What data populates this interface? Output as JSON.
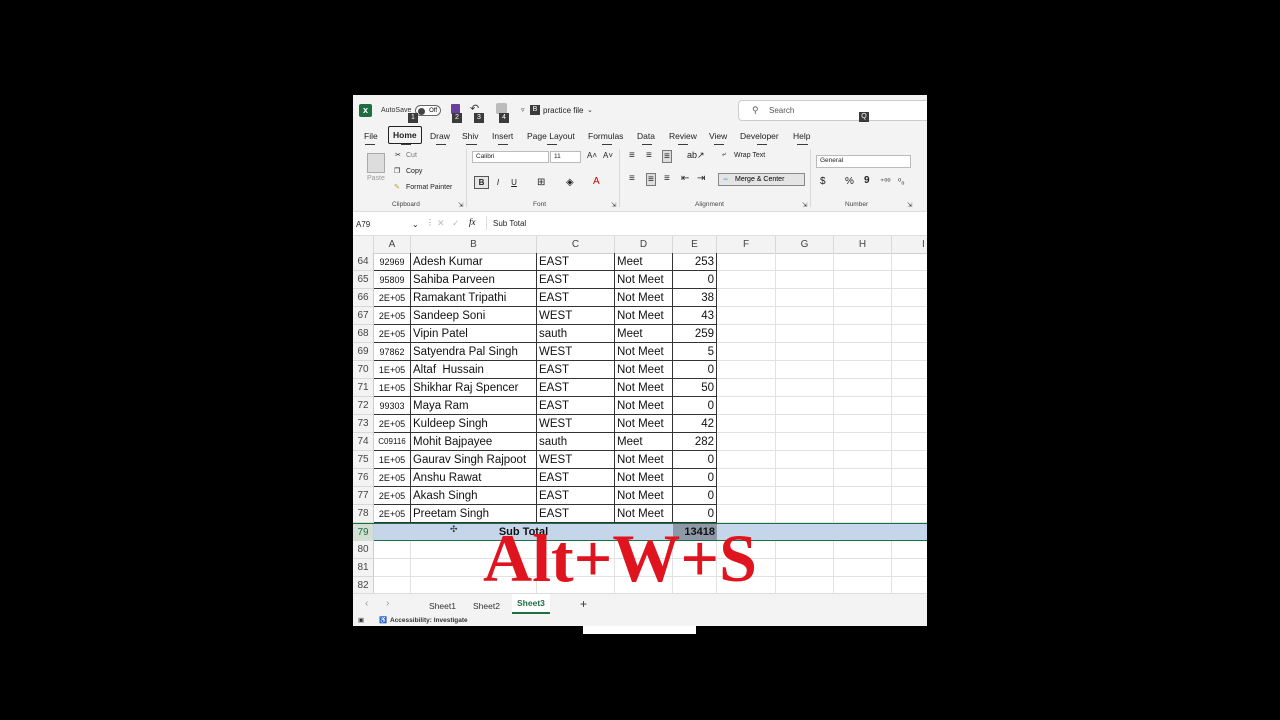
{
  "titlebar": {
    "autosave_label": "AutoSave",
    "autosave_state": "Off",
    "file_name": "practice file",
    "search_placeholder": "Search",
    "keytips": [
      "1",
      "2",
      "3",
      "4",
      "B",
      "Q"
    ]
  },
  "ribbon_tabs": [
    {
      "label": "File",
      "keytip": "F"
    },
    {
      "label": "Home",
      "keytip": "H"
    },
    {
      "label": "Draw",
      "keytip": "JI"
    },
    {
      "label": "Shiv",
      "keytip": "Y1"
    },
    {
      "label": "Insert",
      "keytip": "N"
    },
    {
      "label": "Page Layout",
      "keytip": "P"
    },
    {
      "label": "Formulas",
      "keytip": "M"
    },
    {
      "label": "Data",
      "keytip": "A"
    },
    {
      "label": "Review",
      "keytip": "R"
    },
    {
      "label": "View",
      "keytip": "W"
    },
    {
      "label": "Developer",
      "keytip": "L"
    },
    {
      "label": "Help",
      "keytip": "Y2"
    }
  ],
  "ribbon": {
    "clipboard": {
      "paste": "Paste",
      "cut": "Cut",
      "copy": "Copy",
      "format_painter": "Format Painter",
      "group": "Clipboard"
    },
    "font": {
      "name": "Calibri",
      "size": "11",
      "bold": "B",
      "italic": "I",
      "underline": "U",
      "group": "Font"
    },
    "alignment": {
      "wrap_text": "Wrap Text",
      "merge_center": "Merge & Center",
      "group": "Alignment"
    },
    "number": {
      "format": "General",
      "currency": "$",
      "percent": "%",
      "comma": "9",
      "group": "Number"
    }
  },
  "formula_bar": {
    "name_box": "A79",
    "fx": "fx",
    "content": "Sub Total"
  },
  "columns": [
    "A",
    "B",
    "C",
    "D",
    "E",
    "F",
    "G",
    "H",
    "I"
  ],
  "rows": [
    {
      "num": "64",
      "a": "92969",
      "b": "Adesh Kumar",
      "c": "EAST",
      "d": "Meet",
      "e": "253"
    },
    {
      "num": "65",
      "a": "95809",
      "b": "Sahiba Parveen",
      "c": "EAST",
      "d": "Not Meet",
      "e": "0"
    },
    {
      "num": "66",
      "a": "2E+05",
      "b": "Ramakant Tripathi",
      "c": "EAST",
      "d": "Not Meet",
      "e": "38"
    },
    {
      "num": "67",
      "a": "2E+05",
      "b": "Sandeep Soni",
      "c": "WEST",
      "d": "Not Meet",
      "e": "43"
    },
    {
      "num": "68",
      "a": "2E+05",
      "b": "Vipin Patel",
      "c": "sauth",
      "d": "Meet",
      "e": "259"
    },
    {
      "num": "69",
      "a": "97862",
      "b": "Satyendra Pal Singh",
      "c": "WEST",
      "d": "Not Meet",
      "e": "5"
    },
    {
      "num": "70",
      "a": "1E+05",
      "b": "Altaf  Hussain",
      "c": "EAST",
      "d": "Not Meet",
      "e": "0"
    },
    {
      "num": "71",
      "a": "1E+05",
      "b": "Shikhar Raj Spencer",
      "c": "EAST",
      "d": "Not Meet",
      "e": "50"
    },
    {
      "num": "72",
      "a": "99303",
      "b": "Maya Ram",
      "c": "EAST",
      "d": "Not Meet",
      "e": "0"
    },
    {
      "num": "73",
      "a": "2E+05",
      "b": "Kuldeep Singh",
      "c": "WEST",
      "d": "Not Meet",
      "e": "42"
    },
    {
      "num": "74",
      "a": "C09116",
      "b": "Mohit Bajpayee",
      "c": "sauth",
      "d": "Meet",
      "e": "282"
    },
    {
      "num": "75",
      "a": "1E+05",
      "b": "Gaurav Singh Rajpoot",
      "c": "WEST",
      "d": "Not Meet",
      "e": "0"
    },
    {
      "num": "76",
      "a": "2E+05",
      "b": "Anshu Rawat",
      "c": "EAST",
      "d": "Not Meet",
      "e": "0"
    },
    {
      "num": "77",
      "a": "2E+05",
      "b": "Akash Singh",
      "c": "EAST",
      "d": "Not Meet",
      "e": "0"
    },
    {
      "num": "78",
      "a": "2E+05",
      "b": "Preetam Singh",
      "c": "EAST",
      "d": "Not Meet",
      "e": "0"
    }
  ],
  "subtotal_row": {
    "num": "79",
    "label": "Sub Total",
    "value": "13418"
  },
  "empty_rows": [
    "80",
    "81",
    "82"
  ],
  "sheets": [
    {
      "label": "Sheet1",
      "active": false
    },
    {
      "label": "Sheet2",
      "active": false
    },
    {
      "label": "Sheet3",
      "active": true
    }
  ],
  "add_sheet": "+",
  "status": {
    "accessibility": "Accessibility: Investigate"
  },
  "overlay_text": "Alt+W+S",
  "colors": {
    "excel_green": "#1d6f42",
    "selection_blue": "#c5d5ea",
    "overlay_red": "#e0141e"
  }
}
